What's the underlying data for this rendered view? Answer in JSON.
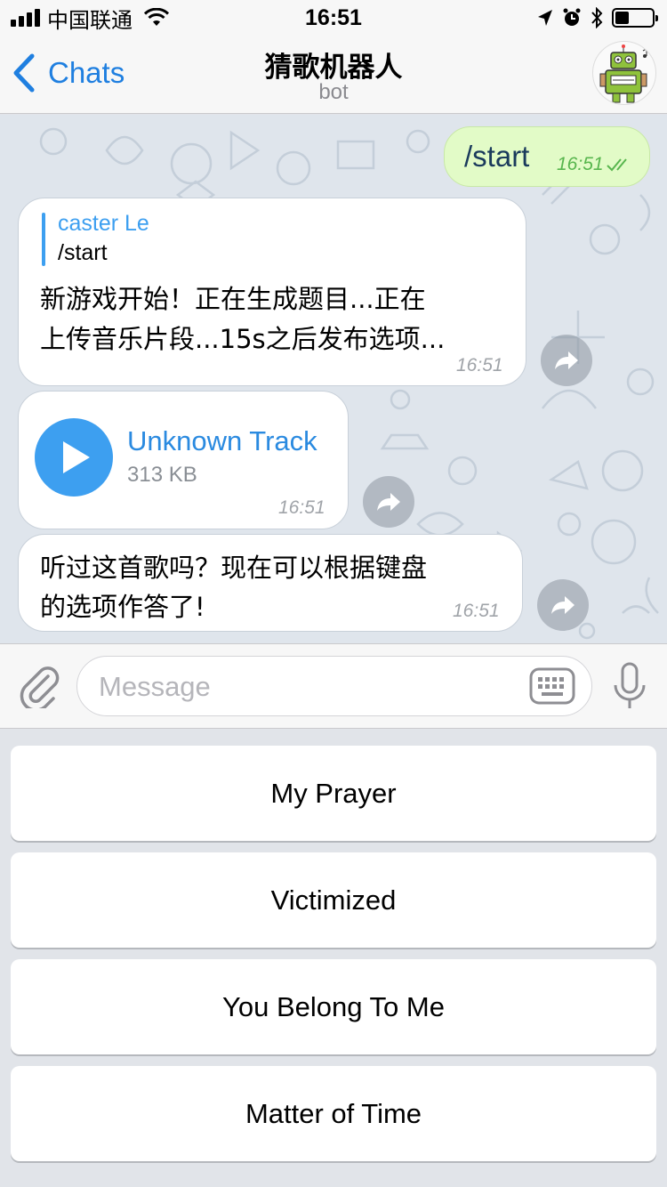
{
  "status_bar": {
    "carrier": "中国联通",
    "time": "16:51"
  },
  "nav": {
    "back_label": "Chats",
    "title": "猜歌机器人",
    "subtitle": "bot"
  },
  "messages": {
    "m1": {
      "text": "/start",
      "time": "16:51"
    },
    "m2": {
      "reply_author": "caster Le",
      "reply_text": "/start",
      "line1": "新游戏开始！正在生成题目...正在",
      "line2": "上传音乐片段...15s之后发布选项...",
      "time": "16:51"
    },
    "m3": {
      "track_title": "Unknown Track",
      "track_size": "313 KB",
      "time": "16:51"
    },
    "m4": {
      "line1": "听过这首歌吗？现在可以根据键盘",
      "line2": "的选项作答了!",
      "time": "16:51"
    }
  },
  "input": {
    "placeholder": "Message"
  },
  "keyboard_buttons": [
    "My Prayer",
    "Victimized",
    "You Belong To Me",
    "Matter of Time"
  ],
  "colors": {
    "accent": "#1f7fe0",
    "outgoing_bubble": "#e2fbc7",
    "chat_background": "#dfe5ec",
    "play_button": "#3d9ff0"
  },
  "icons": [
    "back-chevron-icon",
    "attach-icon",
    "keyboard-icon",
    "microphone-icon",
    "play-icon",
    "forward-icon",
    "double-check-icon"
  ]
}
